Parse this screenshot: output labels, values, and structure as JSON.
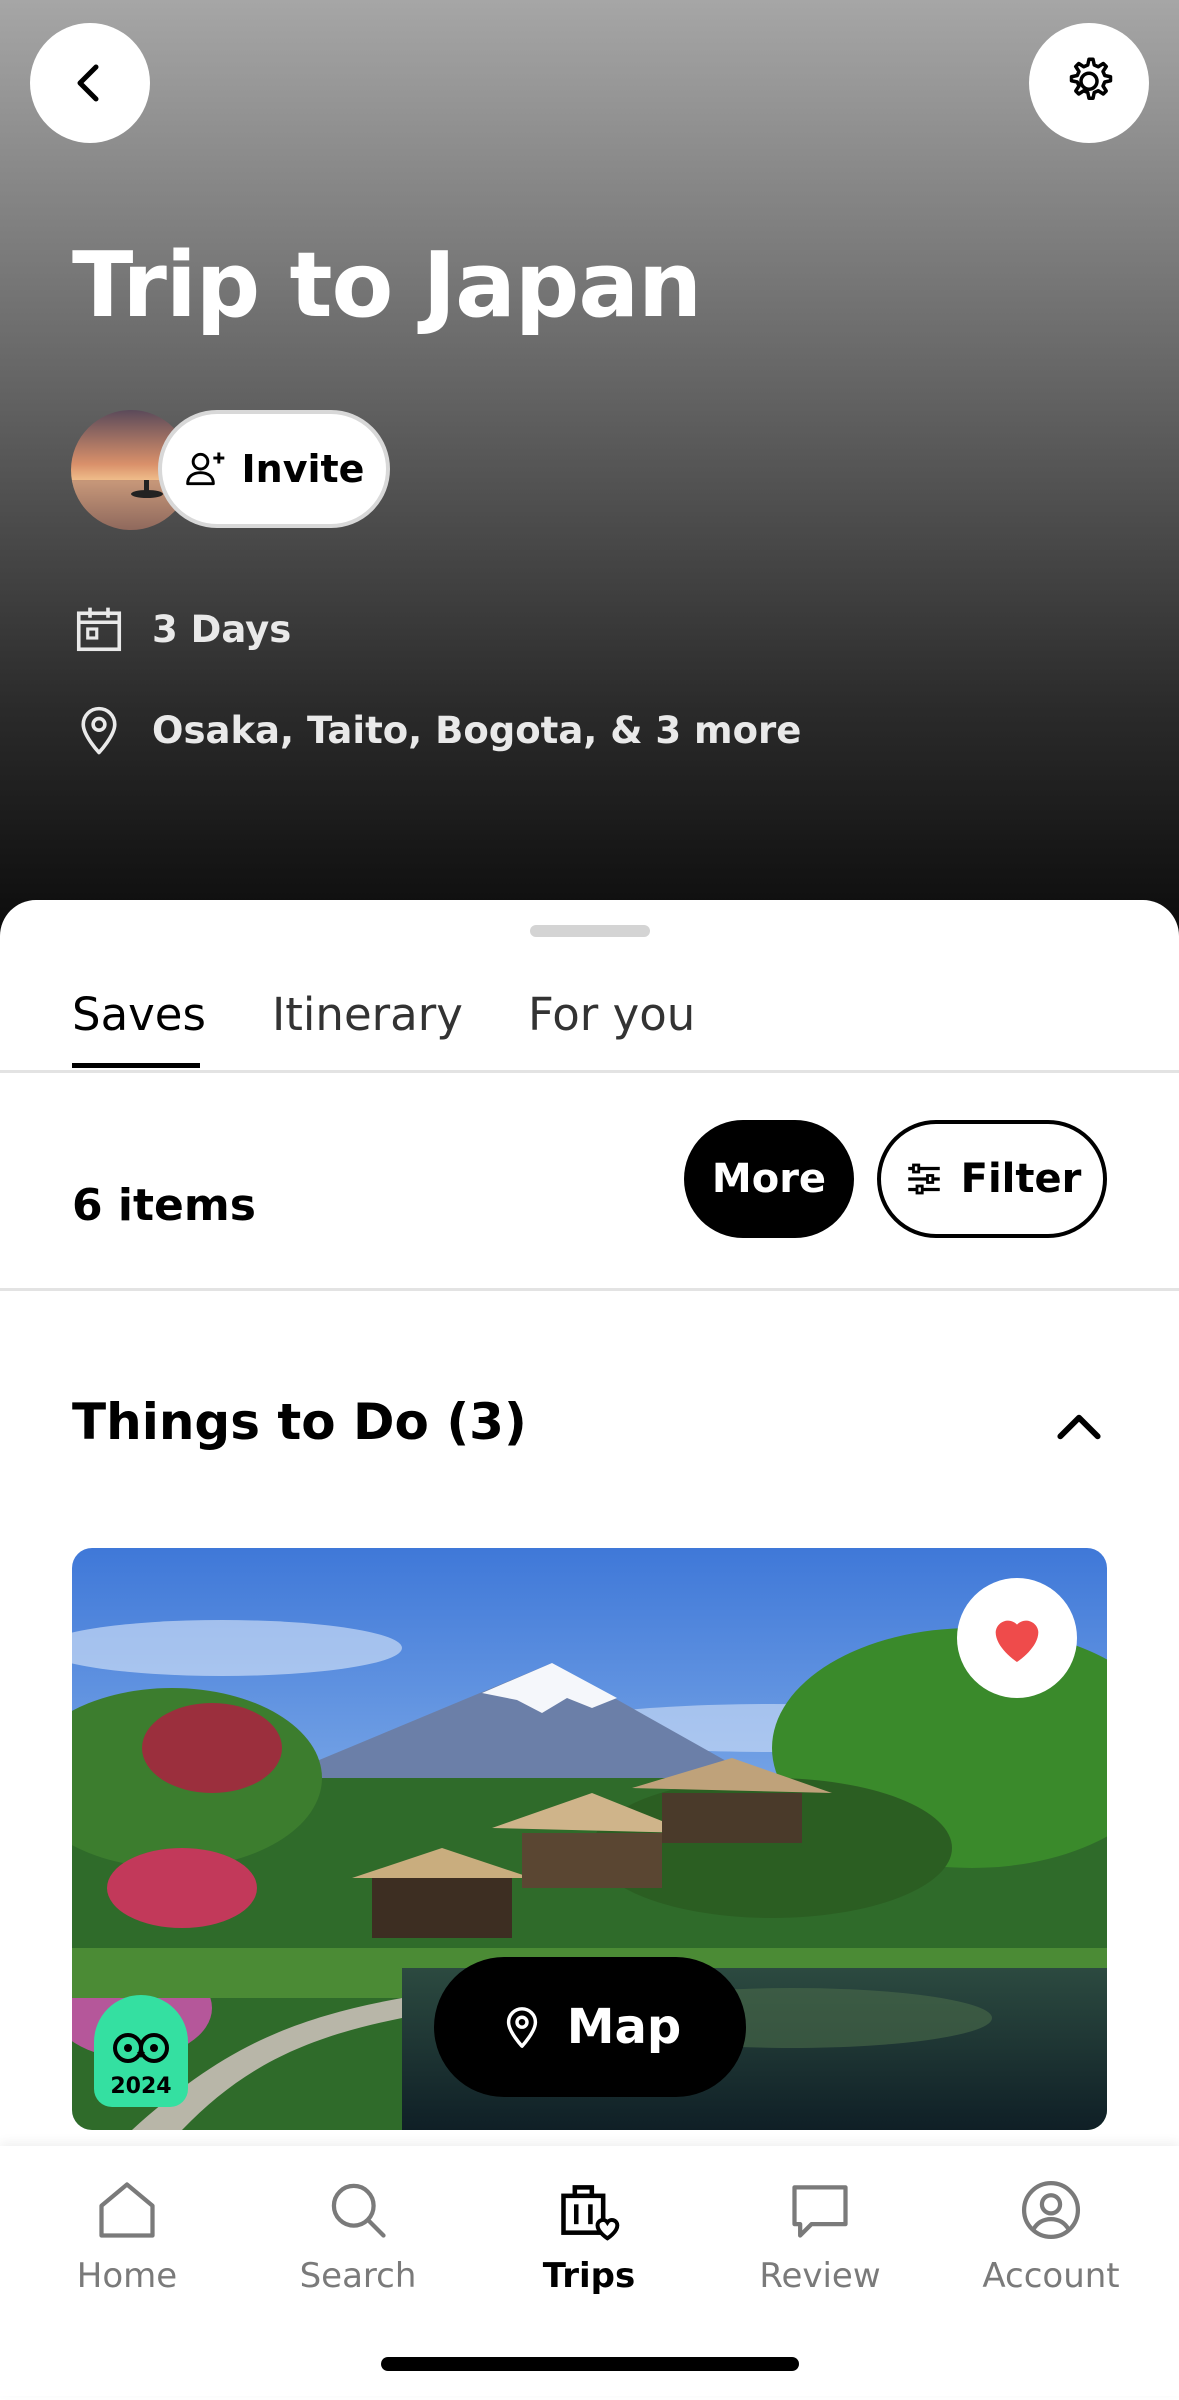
{
  "header": {
    "title": "Trip to Japan",
    "invite_label": "Invite",
    "duration": "3 Days",
    "locations": "Osaka, Taito, Bogota, & 3 more"
  },
  "tabs": [
    {
      "label": "Saves",
      "active": true
    },
    {
      "label": "Itinerary",
      "active": false
    },
    {
      "label": "For you",
      "active": false
    }
  ],
  "toolbar": {
    "items_count": "6 items",
    "more_label": "More",
    "filter_label": "Filter"
  },
  "section": {
    "title": "Things to Do (3)"
  },
  "card": {
    "badge_year": "2024",
    "favorited": true,
    "heart_color": "#ef4b4b",
    "badge_color": "#34e0a1"
  },
  "map_button": {
    "label": "Map"
  },
  "bottom_nav": [
    {
      "label": "Home",
      "icon": "home-icon",
      "active": false
    },
    {
      "label": "Search",
      "icon": "search-icon",
      "active": false
    },
    {
      "label": "Trips",
      "icon": "trips-icon",
      "active": true
    },
    {
      "label": "Review",
      "icon": "review-icon",
      "active": false
    },
    {
      "label": "Account",
      "icon": "account-icon",
      "active": false
    }
  ]
}
